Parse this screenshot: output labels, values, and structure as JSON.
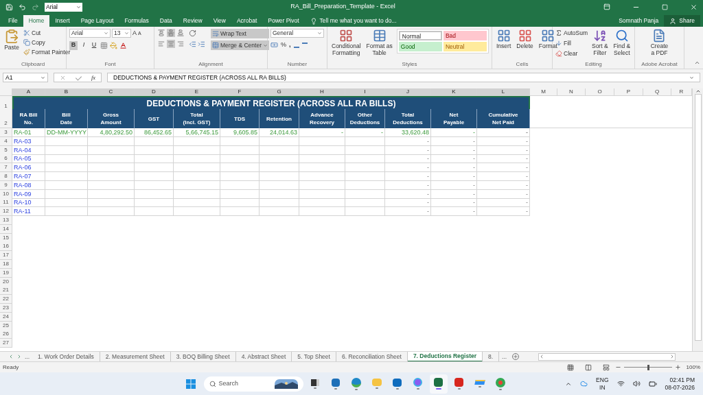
{
  "window": {
    "title": "RA_Bill_Preparation_Template - Excel",
    "font_box": "Arial"
  },
  "ribbon_tabs": [
    {
      "label": "File",
      "selected": false
    },
    {
      "label": "Home",
      "selected": true
    },
    {
      "label": "Insert",
      "selected": false
    },
    {
      "label": "Page Layout",
      "selected": false
    },
    {
      "label": "Formulas",
      "selected": false
    },
    {
      "label": "Data",
      "selected": false
    },
    {
      "label": "Review",
      "selected": false
    },
    {
      "label": "View",
      "selected": false
    },
    {
      "label": "Acrobat",
      "selected": false
    },
    {
      "label": "Power Pivot",
      "selected": false
    }
  ],
  "tell_me": "Tell me what you want to do...",
  "user": "Somnath Panja",
  "share": "Share",
  "ribbon": {
    "clipboard": {
      "label": "Clipboard",
      "paste": "Paste",
      "cut": "Cut",
      "copy": "Copy",
      "format_painter": "Format Painter"
    },
    "font": {
      "label": "Font",
      "name": "Arial",
      "size": "13",
      "grow": "A",
      "shrink": "A",
      "styles": [
        {
          "label": "B",
          "kind": "bold",
          "on": true
        },
        {
          "label": "I",
          "kind": "italic",
          "on": false
        },
        {
          "label": "U",
          "kind": "underline",
          "on": false
        }
      ]
    },
    "alignment": {
      "label": "Alignment",
      "vertical": [
        {
          "kind": "top",
          "on": false
        },
        {
          "kind": "middle",
          "on": true
        },
        {
          "kind": "bottom",
          "on": false
        }
      ],
      "horizontal": [
        {
          "kind": "left",
          "on": false
        },
        {
          "kind": "center",
          "on": true
        },
        {
          "kind": "right",
          "on": false
        }
      ],
      "wrap_text": {
        "label": "Wrap Text",
        "on": true
      },
      "merge": {
        "label": "Merge & Center",
        "on": true
      }
    },
    "number": {
      "label": "Number",
      "format": "General",
      "percent": "%",
      "comma": ","
    },
    "styles": {
      "label": "Styles",
      "conditional": "Conditional\nFormatting",
      "format_table": "Format as\nTable",
      "gallery": [
        {
          "label": "Normal",
          "kind": "normal"
        },
        {
          "label": "Bad",
          "kind": "bad"
        },
        {
          "label": "Good",
          "kind": "good"
        },
        {
          "label": "Neutral",
          "kind": "neutral"
        }
      ]
    },
    "cells": {
      "label": "Cells",
      "buttons": [
        {
          "label": "Insert",
          "kind": "insert"
        },
        {
          "label": "Delete",
          "kind": "delete"
        },
        {
          "label": "Format",
          "kind": "format"
        }
      ]
    },
    "editing": {
      "label": "Editing",
      "autosum": "AutoSum",
      "fill": "Fill",
      "clear": "Clear",
      "sort": "Sort &\nFilter",
      "find": "Find &\nSelect"
    },
    "acrobat": {
      "label": "Adobe Acrobat",
      "create": "Create\na PDF"
    }
  },
  "formula_bar": {
    "name_box": "A1",
    "fx": "fx",
    "content": "DEDUCTIONS & PAYMENT REGISTER (ACROSS ALL RA BILLS)"
  },
  "sheet": {
    "columns": [
      "A",
      "B",
      "C",
      "D",
      "E",
      "F",
      "G",
      "H",
      "I",
      "J",
      "K",
      "L",
      "M",
      "N",
      "O",
      "P",
      "Q",
      "R"
    ],
    "title_row": "1",
    "header_row": "2",
    "title": "DEDUCTIONS & PAYMENT REGISTER (ACROSS ALL RA BILLS)",
    "headers": [
      "RA Bill\nNo.",
      "Bill\nDate",
      "Gross\nAmount",
      "GST",
      "Total\n(Incl. GST)",
      "TDS",
      "Retention",
      "Advance\nRecovery",
      "Other\nDeductions",
      "Total\nDeductions",
      "Net\nPayable",
      "Cumulative\nNet Paid"
    ],
    "rows": [
      {
        "number": "3",
        "kind": "entered",
        "cells": [
          "RA-01",
          "DD-MM-YYYY",
          "4,80,292.50",
          "86,452.65",
          "5,66,745.15",
          "9,605.85",
          "24,014.63",
          "-",
          "-",
          "33,620.48",
          "-",
          "-"
        ]
      },
      {
        "number": "4",
        "kind": "pending",
        "cells": [
          "RA-03",
          "",
          "",
          "",
          "",
          "",
          "",
          "",
          "",
          "-",
          "-",
          "-"
        ]
      },
      {
        "number": "5",
        "kind": "pending",
        "cells": [
          "RA-04",
          "",
          "",
          "",
          "",
          "",
          "",
          "",
          "",
          "-",
          "-",
          "-"
        ]
      },
      {
        "number": "6",
        "kind": "pending",
        "cells": [
          "RA-05",
          "",
          "",
          "",
          "",
          "",
          "",
          "",
          "",
          "-",
          "-",
          "-"
        ]
      },
      {
        "number": "7",
        "kind": "pending",
        "cells": [
          "RA-06",
          "",
          "",
          "",
          "",
          "",
          "",
          "",
          "",
          "-",
          "-",
          "-"
        ]
      },
      {
        "number": "8",
        "kind": "pending",
        "cells": [
          "RA-07",
          "",
          "",
          "",
          "",
          "",
          "",
          "",
          "",
          "-",
          "-",
          "-"
        ]
      },
      {
        "number": "9",
        "kind": "pending",
        "cells": [
          "RA-08",
          "",
          "",
          "",
          "",
          "",
          "",
          "",
          "",
          "-",
          "-",
          "-"
        ]
      },
      {
        "number": "10",
        "kind": "pending",
        "cells": [
          "RA-09",
          "",
          "",
          "",
          "",
          "",
          "",
          "",
          "",
          "-",
          "-",
          "-"
        ]
      },
      {
        "number": "11",
        "kind": "pending",
        "cells": [
          "RA-10",
          "",
          "",
          "",
          "",
          "",
          "",
          "",
          "",
          "-",
          "-",
          "-"
        ]
      },
      {
        "number": "12",
        "kind": "pending",
        "cells": [
          "RA-11",
          "",
          "",
          "",
          "",
          "",
          "",
          "",
          "",
          "-",
          "-",
          "-"
        ]
      }
    ],
    "empty_rows": [
      "13",
      "14",
      "15",
      "16",
      "17",
      "18",
      "19",
      "20",
      "21",
      "22",
      "23",
      "24",
      "25",
      "26",
      "27"
    ]
  },
  "sheet_tabs": {
    "more_left": "...",
    "tabs": [
      {
        "label": "1. Work Order Details",
        "selected": false
      },
      {
        "label": "2. Measurement Sheet",
        "selected": false
      },
      {
        "label": "3. BOQ Billing Sheet",
        "selected": false
      },
      {
        "label": "4. Abstract Sheet",
        "selected": false
      },
      {
        "label": "5. Top Sheet",
        "selected": false
      },
      {
        "label": "6. Reconciliation Sheet",
        "selected": false
      },
      {
        "label": "7. Deductions Register",
        "selected": true
      },
      {
        "label": "8.",
        "selected": false
      }
    ],
    "more_right": "..."
  },
  "status_bar": {
    "text": "Ready",
    "zoom": "100%",
    "zoom_slider": {
      "level": 0.5
    }
  },
  "taskbar": {
    "search": "Search",
    "language": "ENG\nIN",
    "time": "02:41 PM",
    "date": "08-07-2026"
  }
}
